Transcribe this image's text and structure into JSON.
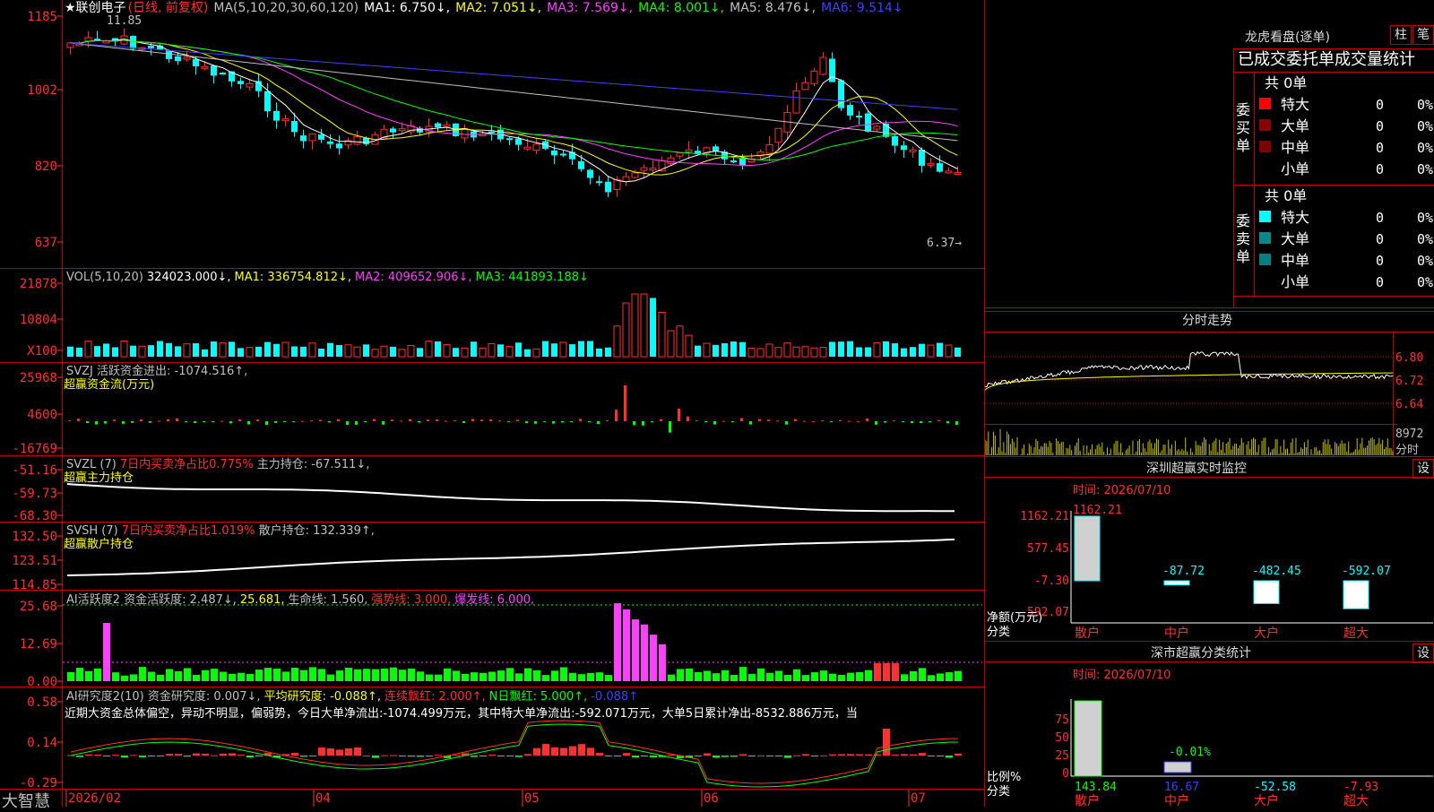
{
  "app": {
    "logo": "大智慧"
  },
  "main": {
    "stock_name": "★联创电子",
    "kind": "(日线, 前复权)",
    "ma_header": [
      {
        "label": "MA(5,10,20,30,60,120)",
        "color": "#c0c0c0"
      },
      {
        "label": "MA1: 6.750↓,",
        "color": "#ffffff"
      },
      {
        "label": "MA2: 7.051↓,",
        "color": "#ffff00"
      },
      {
        "label": "MA3: 7.569↓,",
        "color": "#ff40ff"
      },
      {
        "label": "MA4: 8.001↓,",
        "color": "#00ff00"
      },
      {
        "label": "MA5: 8.476↓,",
        "color": "#c0c0c0"
      },
      {
        "label": "MA6: 9.514↓",
        "color": "#4040ff"
      }
    ],
    "price_axis": [
      "1185",
      "1002",
      "820",
      "637"
    ],
    "high_label": "11.85",
    "low_label": "6.37"
  },
  "vol": {
    "header": [
      {
        "label": "VOL(5,10,20)",
        "color": "#c0c0c0"
      },
      {
        "label": "324023.000↓,",
        "color": "#ffffff"
      },
      {
        "label": "MA1: 336754.812↓,",
        "color": "#ffff00"
      },
      {
        "label": "MA2: 409652.906↓,",
        "color": "#ff40ff"
      },
      {
        "label": "MA3: 441893.188↓",
        "color": "#00ff00"
      }
    ],
    "axis": [
      "21878",
      "10804",
      "X100"
    ]
  },
  "svzj": {
    "header": [
      {
        "label": "SVZJ  活跃资金进出: -1074.516↑,",
        "color": "#c0c0c0"
      }
    ],
    "sub": "超赢资金流(万元)",
    "axis": [
      "25968",
      "4600",
      "-16769"
    ]
  },
  "svzl": {
    "header": [
      {
        "label": "SVZL (7)",
        "color": "#c0c0c0"
      },
      {
        "label": "7日内买卖净占比0.775%",
        "color": "#ff3030"
      },
      {
        "label": "主力持仓: -67.511↓,",
        "color": "#c0c0c0"
      }
    ],
    "sub": "超赢主力持仓",
    "axis": [
      "-51.16",
      "-59.73",
      "-68.30"
    ]
  },
  "svsh": {
    "header": [
      {
        "label": "SVSH (7)",
        "color": "#c0c0c0"
      },
      {
        "label": "7日内买卖净占比1.019%",
        "color": "#ff3030"
      },
      {
        "label": "散户持仓: 132.339↑,",
        "color": "#c0c0c0"
      }
    ],
    "sub": "超赢散户持仓",
    "axis": [
      "132.50",
      "123.51",
      "114.85"
    ]
  },
  "ai": {
    "header": [
      {
        "label": "AI活跃度2 资金活跃度: 2.487↓,",
        "color": "#c0c0c0"
      },
      {
        "label": "25.681,",
        "color": "#ffff00"
      },
      {
        "label": "生命线: 1.560,",
        "color": "#c0c0c0"
      },
      {
        "label": "强势线: 3.000,",
        "color": "#ff3030"
      },
      {
        "label": "爆发线: 6.000,",
        "color": "#ff40ff"
      }
    ],
    "axis": [
      "25.68",
      "12.69",
      "0.00"
    ]
  },
  "research": {
    "header": [
      {
        "label": "AI研究度2(10) 资金研究度: 0.007↓,",
        "color": "#c0c0c0"
      },
      {
        "label": "平均研究度: -0.088↑,",
        "color": "#ffff00"
      },
      {
        "label": "连续飘红: 2.000↑,",
        "color": "#ff3030"
      },
      {
        "label": "N日飘红: 5.000↑,",
        "color": "#00ff00"
      },
      {
        "label": "-0.088↑",
        "color": "#4040ff"
      }
    ],
    "comment": "近期大资金总体偏空，异动不明显，偏弱势，今日大单净流出:-1074.499万元，其中特大单净流出:-592.071万元，大单5日累计净出-8532.886万元，当",
    "axis": [
      "0.58",
      "0.14",
      "-0.29"
    ]
  },
  "xaxis": [
    "2026/02",
    "04",
    "05",
    "06",
    "07"
  ],
  "dragon": {
    "title": "龙虎看盘(逐单)",
    "btn1": "柱",
    "btn2": "笔",
    "header": "已成交委托单成交量统计",
    "buy_total": "共 0单",
    "buy_label": "委买单",
    "sell_total": "共 0单",
    "sell_label": "委卖单",
    "buy_rows": [
      {
        "name": "特大",
        "v": "0",
        "p": "0%",
        "color": "#ff0000"
      },
      {
        "name": "大单",
        "v": "0",
        "p": "0%",
        "color": "#8b0000"
      },
      {
        "name": "中单",
        "v": "0",
        "p": "0%",
        "color": "#800000"
      },
      {
        "name": "小单",
        "v": "0",
        "p": "0%",
        "color": ""
      }
    ],
    "sell_rows": [
      {
        "name": "特大",
        "v": "0",
        "p": "0%",
        "color": "#00ffff"
      },
      {
        "name": "大单",
        "v": "0",
        "p": "0%",
        "color": "#008b8b"
      },
      {
        "name": "中单",
        "v": "0",
        "p": "0%",
        "color": "#008080"
      },
      {
        "name": "小单",
        "v": "0",
        "p": "0%",
        "color": ""
      }
    ]
  },
  "intraday": {
    "title": "分时走势",
    "axis": [
      "6.80",
      "6.72",
      "6.64"
    ],
    "vol_top": "8972",
    "vol_label": "分时"
  },
  "monitor": {
    "title": "深圳超赢实时监控",
    "set": "设",
    "time": "时间: 2026/07/10",
    "axis": [
      "1162.21",
      "577.45",
      "-7.30",
      "-592.07"
    ],
    "ylabel": "净额(万元)",
    "xlabel": "分类",
    "cats": [
      "散户",
      "中户",
      "大户",
      "超大"
    ],
    "values": [
      1162.21,
      -87.72,
      -482.45,
      -592.07
    ],
    "value_labels": [
      "1162.21",
      "-87.72",
      "-482.45",
      "-592.07"
    ]
  },
  "classify": {
    "title": "深市超赢分类统计",
    "set": "设",
    "time": "时间: 2026/07/10",
    "axis": [
      "75",
      "50",
      "25",
      "0"
    ],
    "ylabel": "比例%",
    "xlabel": "分类",
    "cats": [
      "散户",
      "中户",
      "大户",
      "超大"
    ],
    "inner_label": "-0.01%",
    "bottom_values": [
      "143.84",
      "16.67",
      "-52.58",
      "-7.93"
    ]
  }
}
